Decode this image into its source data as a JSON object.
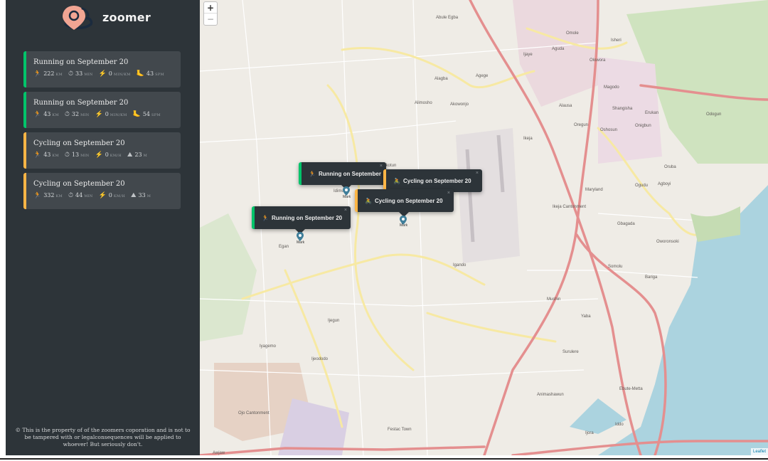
{
  "app": {
    "name": "zoomer",
    "logo_icon": "map-pin-icon",
    "colors": {
      "sidebar": "#2d3439",
      "running": "#00c46a",
      "cycling": "#ffb545"
    }
  },
  "workouts": [
    {
      "type": "running",
      "title": "Running on September 20",
      "details": [
        {
          "icon": "🏃",
          "icon_name": "runner-icon",
          "value": "222",
          "unit": "km"
        },
        {
          "icon": "⏱",
          "icon_name": "clock-icon",
          "value": "33",
          "unit": "min"
        },
        {
          "icon": "⚡",
          "icon_name": "lightning-icon",
          "value": "0",
          "unit": "min/km"
        },
        {
          "icon": "🦶",
          "icon_name": "footprint-icon",
          "value": "43",
          "unit": "spm"
        }
      ]
    },
    {
      "type": "running",
      "title": "Running on September 20",
      "details": [
        {
          "icon": "🏃",
          "icon_name": "runner-icon",
          "value": "43",
          "unit": "km"
        },
        {
          "icon": "⏱",
          "icon_name": "clock-icon",
          "value": "32",
          "unit": "min"
        },
        {
          "icon": "⚡",
          "icon_name": "lightning-icon",
          "value": "0",
          "unit": "min/km"
        },
        {
          "icon": "🦶",
          "icon_name": "footprint-icon",
          "value": "54",
          "unit": "spm"
        }
      ]
    },
    {
      "type": "cycling",
      "title": "Cycling on September 20",
      "details": [
        {
          "icon": "🏃",
          "icon_name": "runner-icon",
          "value": "43",
          "unit": "km"
        },
        {
          "icon": "⏱",
          "icon_name": "clock-icon",
          "value": "13",
          "unit": "min"
        },
        {
          "icon": "⚡",
          "icon_name": "lightning-icon",
          "value": "0",
          "unit": "km/h"
        },
        {
          "icon": "⛰",
          "icon_name": "mountain-icon",
          "value": "23",
          "unit": "m"
        }
      ]
    },
    {
      "type": "cycling",
      "title": "Cycling on September 20",
      "details": [
        {
          "icon": "🏃",
          "icon_name": "runner-icon",
          "value": "332",
          "unit": "km"
        },
        {
          "icon": "⏱",
          "icon_name": "clock-icon",
          "value": "44",
          "unit": "min"
        },
        {
          "icon": "⚡",
          "icon_name": "lightning-icon",
          "value": "0",
          "unit": "km/h"
        },
        {
          "icon": "⛰",
          "icon_name": "mountain-icon",
          "value": "33",
          "unit": "m"
        }
      ]
    }
  ],
  "footer": {
    "text": "© This is the property of of the zoomers coporation and is not to be tampered with or legalconsequences will be applied to whoever! But seriously don't."
  },
  "map": {
    "zoom_in": "+",
    "zoom_out": "−",
    "attribution": "Leaflet",
    "popups": [
      {
        "type": "running",
        "icon": "🏃",
        "text": "Running on September",
        "close": "×"
      },
      {
        "type": "cycling",
        "icon": "🚴",
        "text": "Cycling on September 20",
        "close": "×"
      },
      {
        "type": "cycling",
        "icon": "🚴",
        "text": "Cycling on September 20",
        "close": "×"
      },
      {
        "type": "running",
        "icon": "🏃",
        "text": "Running on September 20",
        "close": "×"
      }
    ],
    "marker_labels": [
      "Mark",
      "Mark",
      "Mark"
    ],
    "place_labels": [
      "Abule Egba",
      "Omole",
      "Isheri",
      "Aguda",
      "Ijaye",
      "Olowora",
      "Agege",
      "Alagba",
      "Magodo",
      "Alimosho",
      "Akowonjo",
      "Alausa",
      "Shangisha",
      "Erukan",
      "Odogun",
      "Oregun",
      "Onigbun",
      "Ikeja",
      "Oshosun",
      "Oruba",
      "Maryland",
      "Ogudu",
      "Agboyi",
      "Ikeja Cantonment",
      "Gbagada",
      "Oworonsoki",
      "Idimu",
      "Egan",
      "Somolu",
      "Bariga",
      "Igando",
      "Mushin",
      "Yaba",
      "Ijegun",
      "Surulere",
      "Iyagemo",
      "Ijeododo",
      "Animashawun",
      "Ebute-Metta",
      "Ojo Cantonment",
      "Festac Town",
      "Ijora",
      "Iddo",
      "Awjaw",
      "Ikotun"
    ]
  }
}
